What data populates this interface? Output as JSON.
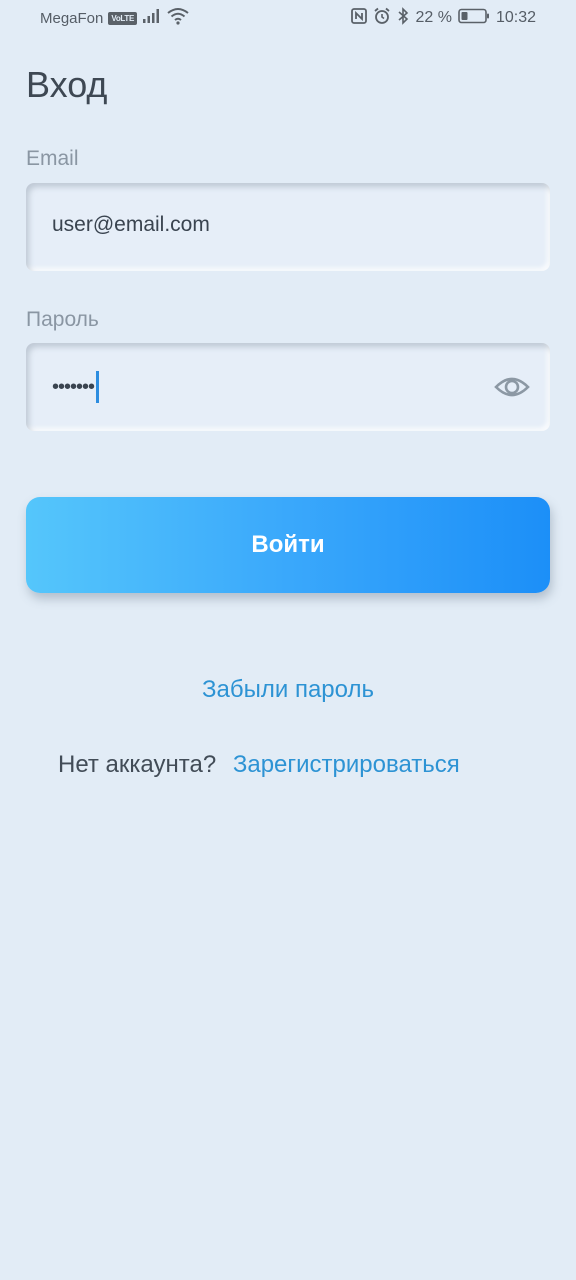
{
  "status_bar": {
    "carrier": "MegaFon",
    "volte": "VoLTE",
    "battery_percent": "22 %",
    "time": "10:32",
    "icons": [
      "signal-icon",
      "wifi-icon",
      "nfc-icon",
      "alarm-icon",
      "bluetooth-icon",
      "battery-icon"
    ]
  },
  "page": {
    "title": "Вход"
  },
  "email": {
    "label": "Email",
    "value": "user@email.com"
  },
  "password": {
    "label": "Пароль",
    "masked_value": "•••••••",
    "toggle_icon": "eye-icon"
  },
  "login_button": {
    "label": "Войти"
  },
  "links": {
    "forgot_password": "Забыли пароль",
    "no_account": "Нет аккаунта?",
    "register": "Зарегистрироваться"
  },
  "colors": {
    "background": "#e2ecf6",
    "accent_link": "#2d93d4",
    "button_gradient_start": "#55c6fb",
    "button_gradient_end": "#1c8ff8"
  }
}
